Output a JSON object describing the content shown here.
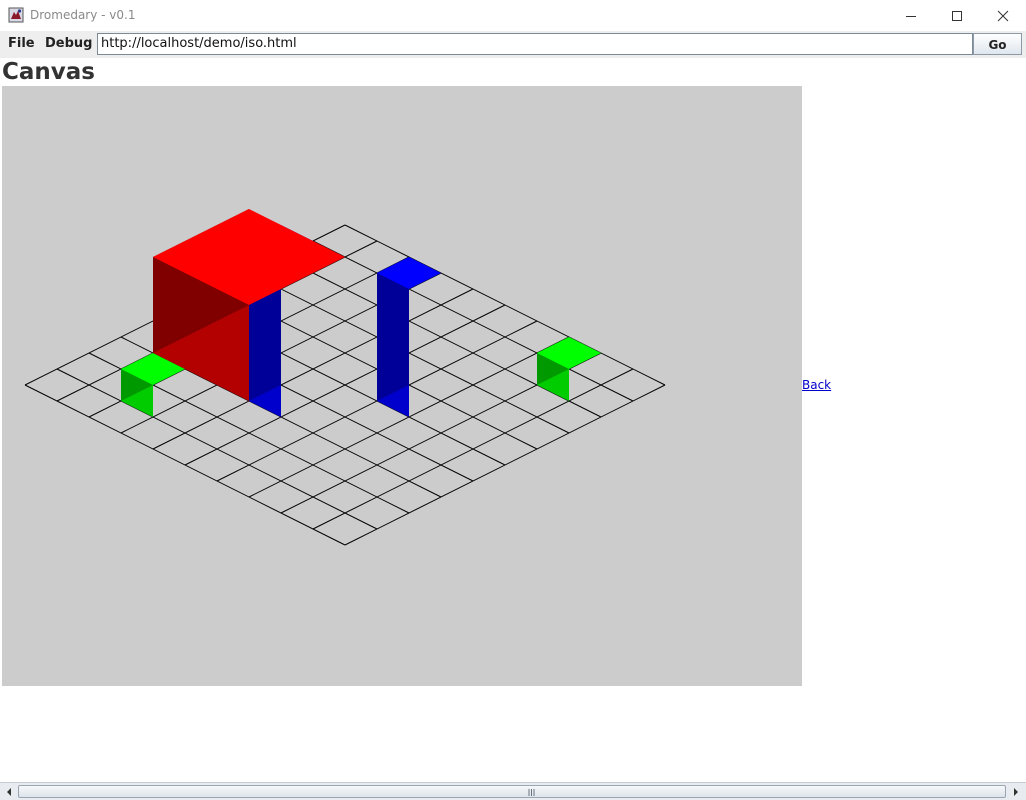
{
  "window": {
    "title": "Dromedary - v0.1",
    "icons": {
      "app": "dromedary-app-icon",
      "minimize": "minimize-icon",
      "maximize": "maximize-icon",
      "close": "close-icon"
    }
  },
  "toolbar": {
    "menus": [
      "File",
      "Debug"
    ],
    "url": "http://localhost/demo/iso.html",
    "go_label": "Go"
  },
  "page": {
    "heading": "Canvas",
    "back_link": "Back"
  },
  "scene": {
    "background": "#cccccc",
    "grid": {
      "rows": 10,
      "cols": 10,
      "line_color": "#000000"
    },
    "blocks": [
      {
        "color": "blue",
        "col": 3,
        "row": 4,
        "width": 1,
        "depth": 1,
        "height": 5
      },
      {
        "color": "blue",
        "col": 5,
        "row": 6,
        "width": 1,
        "depth": 1,
        "height": 4
      },
      {
        "color": "green",
        "col": 1,
        "row": 2,
        "width": 1,
        "depth": 1,
        "height": 1
      },
      {
        "color": "green",
        "col": 8,
        "row": 8,
        "width": 1,
        "depth": 1,
        "height": 1
      },
      {
        "color": "red",
        "col": 3,
        "row": 1,
        "width": 3,
        "depth": 3,
        "height": 3
      }
    ],
    "palettes": {
      "blue": {
        "top": "#0000ff",
        "left": "#0000cc",
        "right": "#000099"
      },
      "green": {
        "top": "#00ff00",
        "left": "#00cc00",
        "right": "#009900"
      },
      "red": {
        "top": "#ff0000",
        "left": "#b30000",
        "right": "#800000"
      }
    }
  }
}
